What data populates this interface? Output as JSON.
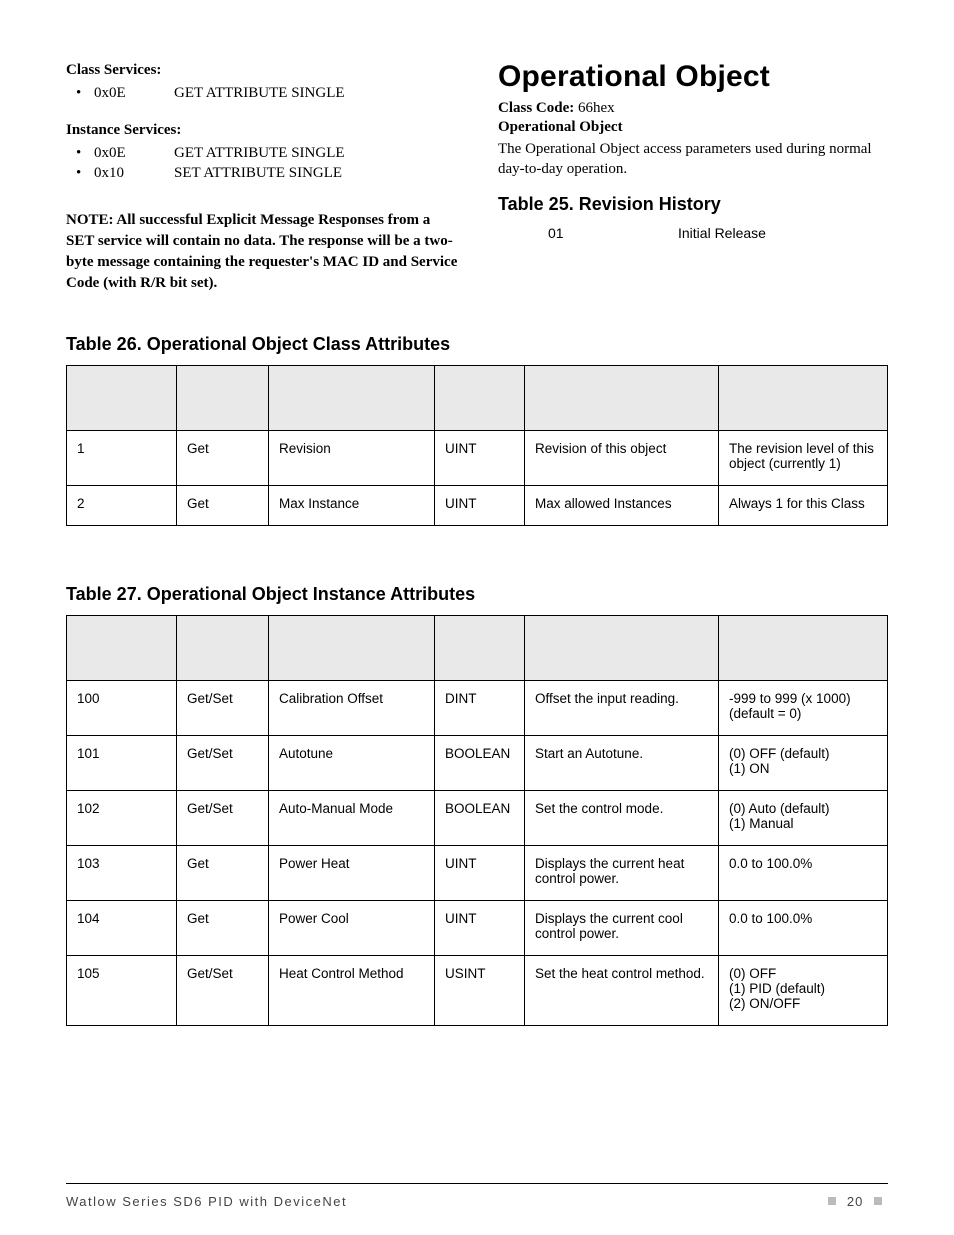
{
  "left": {
    "class_services_label": "Class Services:",
    "class_services": [
      {
        "code": "0x0E",
        "name": "GET ATTRIBUTE SINGLE"
      }
    ],
    "instance_services_label": "Instance Services:",
    "instance_services": [
      {
        "code": "0x0E",
        "name": "GET ATTRIBUTE SINGLE"
      },
      {
        "code": "0x10",
        "name": "SET ATTRIBUTE SINGLE"
      }
    ],
    "note": "NOTE: All successful Explicit Message Responses from a SET service will contain no data. The response will be a two-byte message containing the requester's MAC ID and Service Code (with R/R bit set)."
  },
  "right": {
    "heading": "Operational Object",
    "classcode_label": "Class Code:",
    "classcode_value": "66hex",
    "subhead": "Operational Object",
    "description": "The Operational Object access parameters used during normal day-to-day operation.",
    "table25_title": "Table 25. Revision History",
    "rev_row": {
      "rev": "01",
      "desc": "Initial Release"
    }
  },
  "table26": {
    "title": "Table 26. Operational Object Class Attributes",
    "rows": [
      {
        "c1": "1",
        "c2": "Get",
        "c3": "Revision",
        "c4": "UINT",
        "c5": "Revision of this object",
        "c6": "The revision level of this object (currently 1)"
      },
      {
        "c1": "2",
        "c2": "Get",
        "c3": "Max Instance",
        "c4": "UINT",
        "c5": "Max allowed Instances",
        "c6": "Always 1 for this Class"
      }
    ]
  },
  "table27": {
    "title": "Table 27. Operational Object Instance Attributes",
    "rows": [
      {
        "c1": "100",
        "c2": "Get/Set",
        "c3": "Calibration Offset",
        "c4": "DINT",
        "c5": "Offset the input reading.",
        "c6": "-999 to 999 (x 1000)\n(default = 0)"
      },
      {
        "c1": "101",
        "c2": "Get/Set",
        "c3": "Autotune",
        "c4": "BOOLEAN",
        "c5": "Start an Autotune.",
        "c6": "(0) OFF (default)\n(1) ON"
      },
      {
        "c1": "102",
        "c2": "Get/Set",
        "c3": "Auto-Manual Mode",
        "c4": "BOOLEAN",
        "c5": "Set the control mode.",
        "c6": "(0) Auto (default)\n(1) Manual"
      },
      {
        "c1": "103",
        "c2": "Get",
        "c3": "Power Heat",
        "c4": "UINT",
        "c5": "Displays the current heat control power.",
        "c6": "0.0 to 100.0%"
      },
      {
        "c1": "104",
        "c2": "Get",
        "c3": "Power Cool",
        "c4": "UINT",
        "c5": "Displays the current cool control power.",
        "c6": "0.0 to 100.0%"
      },
      {
        "c1": "105",
        "c2": "Get/Set",
        "c3": "Heat Control Method",
        "c4": "USINT",
        "c5": "Set the heat control method.",
        "c6": "(0) OFF\n(1) PID (default)\n(2) ON/OFF"
      }
    ]
  },
  "footer": {
    "left": "Watlow Series SD6 PID with DeviceNet",
    "page": "20"
  }
}
